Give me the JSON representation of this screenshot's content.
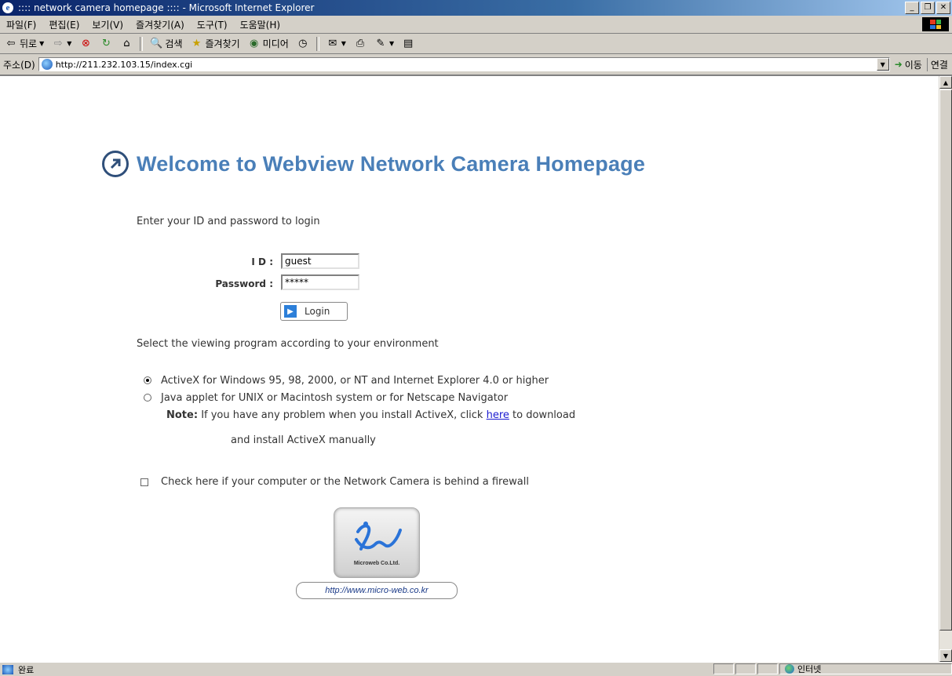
{
  "window": {
    "title": ":::: network camera homepage :::: - Microsoft Internet Explorer"
  },
  "menu": [
    "파일(F)",
    "편집(E)",
    "보기(V)",
    "즐겨찾기(A)",
    "도구(T)",
    "도움말(H)"
  ],
  "toolbar": {
    "back": "뒤로",
    "search": "검색",
    "favorites": "즐겨찾기",
    "media": "미디어"
  },
  "address": {
    "label": "주소(D)",
    "url": "http://211.232.103.15/index.cgi",
    "go": "이동",
    "links": "연결"
  },
  "page": {
    "heading": "Welcome to Webview Network Camera Homepage",
    "login_prompt": "Enter your ID and password to login",
    "id_label": "I D :",
    "id_value": "guest",
    "password_label": "Password :",
    "password_value": "*****",
    "login_button": "Login",
    "viewer_prompt": "Select the viewing program according to your environment",
    "option_activex": "ActiveX for Windows 95, 98, 2000, or NT and Internet Explorer 4.0 or higher",
    "option_java": "Java applet for UNIX or Macintosh system or for Netscape Navigator",
    "note_label": "Note:",
    "note_text_1": "If you have any problem when you install ActiveX, click",
    "note_link": "here",
    "note_text_2": "to download",
    "note_text_3": "and install ActiveX manually",
    "firewall_label": "Check here if your computer or the Network Camera is behind a firewall",
    "logo_caption": "Microweb Co.Ltd.",
    "logo_url": "http://www.micro-web.co.kr",
    "selected_viewer": "activex",
    "firewall_checked": false
  },
  "status": {
    "text": "완료",
    "zone": "인터넷"
  },
  "colors": {
    "heading": "#4a7fb8",
    "titlebar": "#0a246a",
    "link": "#1a1ad0"
  }
}
